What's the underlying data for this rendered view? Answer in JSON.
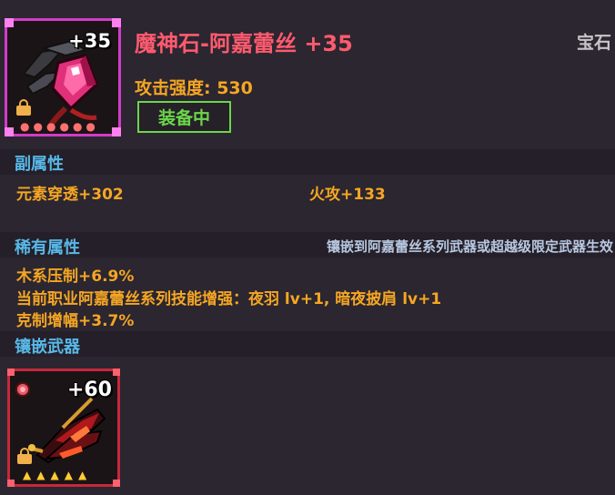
{
  "item": {
    "name": "魔神石-阿嘉蕾丝 +35",
    "category": "宝石",
    "level_badge": "+35",
    "attack": "攻击强度: 530",
    "status": "装备中",
    "star_count": 6,
    "icon": "gem-icon",
    "frame_color": "#d23cc8"
  },
  "sub_attributes": {
    "header": "副属性",
    "stats": [
      "元素穿透+302",
      "火攻+133"
    ]
  },
  "rare_attributes": {
    "header": "稀有属性",
    "note": "镶嵌到阿嘉蕾丝系列武器或超越级限定武器生效",
    "stats": [
      "木系压制+6.9%",
      "当前职业阿嘉蕾丝系列技能增强：夜羽 lv+1, 暗夜披肩 lv+1",
      "克制增幅+3.7%"
    ]
  },
  "socket_weapon": {
    "header": "镶嵌武器",
    "level_badge": "+60",
    "star_count": 5,
    "icon": "crossbow-weapon-icon",
    "frame_color": "#c6283c"
  }
}
